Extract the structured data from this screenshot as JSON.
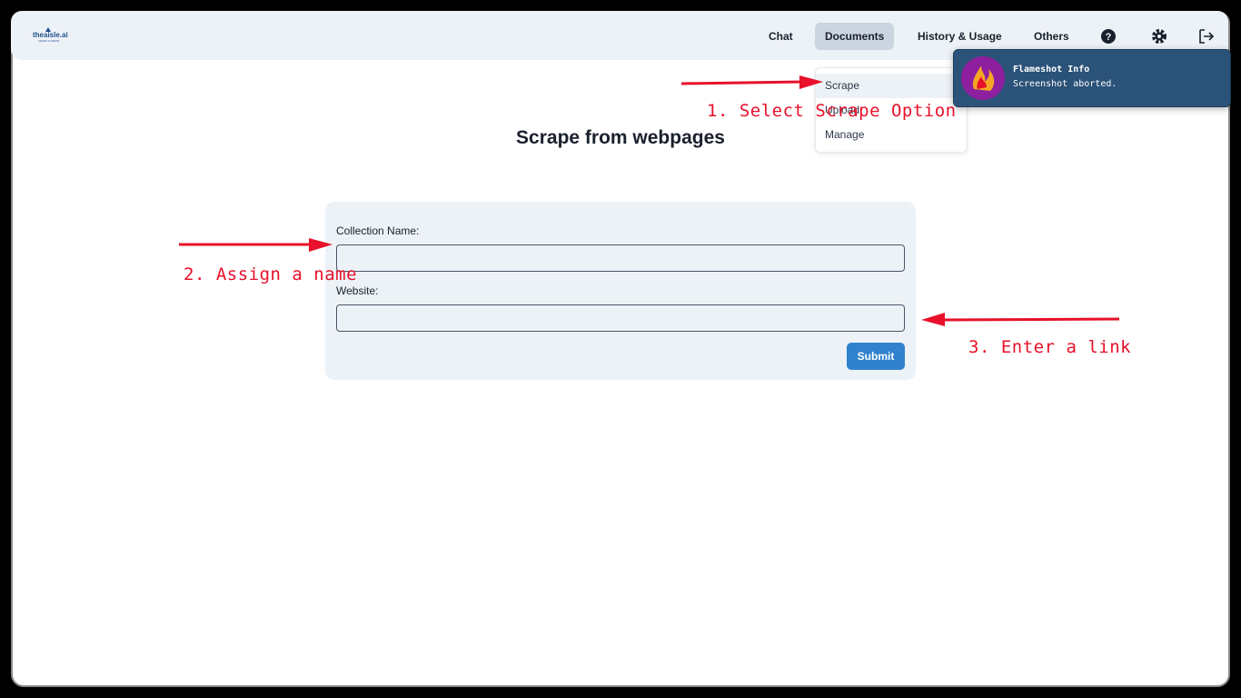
{
  "brand": {
    "logo_text": "theaisle.ai",
    "logo_subtext": "LEARN & GROW"
  },
  "nav": {
    "chat": "Chat",
    "documents": "Documents",
    "history": "History & Usage",
    "others": "Others",
    "icons": [
      "help-icon",
      "settings-icon",
      "logout-icon"
    ]
  },
  "dropdown": {
    "items": [
      "Scrape",
      "Upload",
      "Manage"
    ],
    "active": "Scrape"
  },
  "page": {
    "title": "Scrape from webpages"
  },
  "form": {
    "collection_label": "Collection Name:",
    "collection_value": "",
    "website_label": "Website:",
    "website_value": "",
    "submit_label": "Submit"
  },
  "notification": {
    "title": "Flameshot Info",
    "body": "Screenshot aborted."
  },
  "annotations": {
    "step1": "1. Select Scrape Option",
    "step2": "2. Assign a name",
    "step3": "3. Enter a link",
    "color": "#e8102a"
  },
  "colors": {
    "primary": "#3182ce",
    "navbar_bg": "#edf2f7",
    "toast_bg": "#2b5278"
  }
}
